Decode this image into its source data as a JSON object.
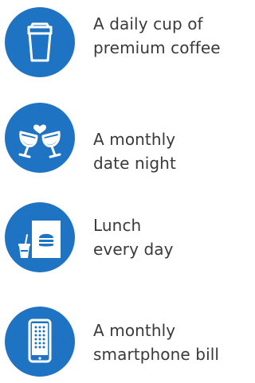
{
  "colors": {
    "accent": "#1f73c3",
    "text": "#3a3a3a",
    "icon_fg": "#ffffff"
  },
  "items": [
    {
      "icon": "coffee-cup-icon",
      "line1": "A daily cup of",
      "line2": "premium coffee"
    },
    {
      "icon": "wine-glasses-heart-icon",
      "line1": "A monthly",
      "line2": "date night"
    },
    {
      "icon": "lunch-meal-icon",
      "line1": "Lunch",
      "line2": "every day"
    },
    {
      "icon": "smartphone-icon",
      "line1": "A monthly",
      "line2": "smartphone bill"
    }
  ]
}
